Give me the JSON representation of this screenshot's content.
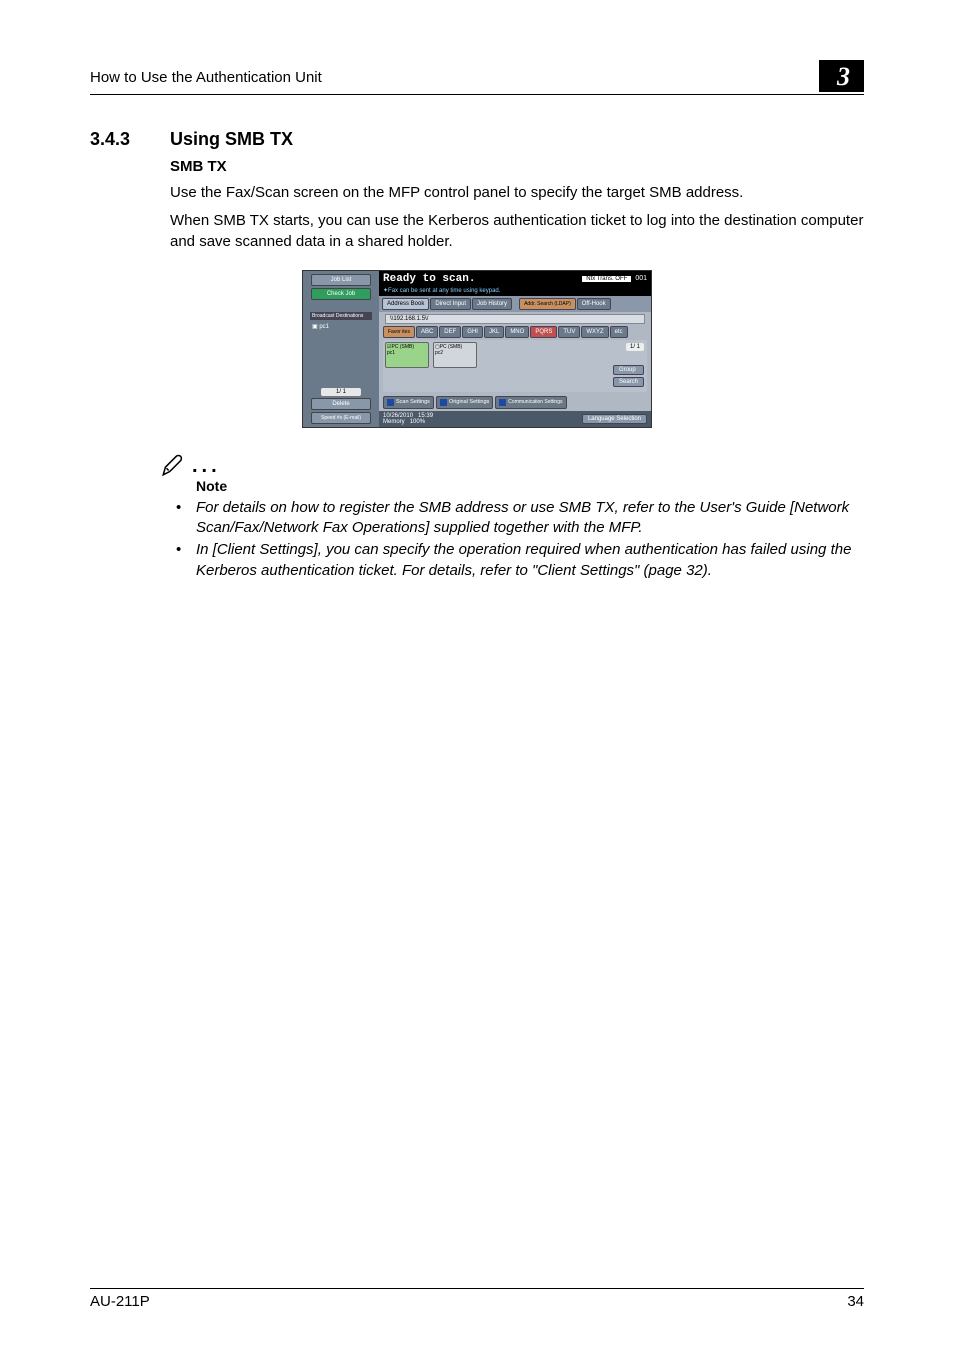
{
  "header": {
    "runningTitle": "How to Use the Authentication Unit",
    "chapterNumber": "3"
  },
  "section": {
    "number": "3.4.3",
    "title": "Using SMB TX",
    "subheading": "SMB TX",
    "paragraph1": "Use the Fax/Scan screen on the MFP control panel to specify the target SMB address.",
    "paragraph2": "When SMB TX starts, you can use the Kerberos authentication ticket to log into the destination computer and save scanned data in a shared holder."
  },
  "panel": {
    "left": {
      "jobList": "Job List",
      "checkJob": "Check Job",
      "destTitle": "Broadcast Destinations",
      "destItem": "▣ pc1",
      "pager": "1/  1",
      "delete": "Delete",
      "speed": "Speed #s (E-mail)"
    },
    "status": {
      "title": "Ready to scan.",
      "hint": "✦Fax can be sent at any time using keypad.",
      "memLabel": "Ntx Trans. OFF",
      "count": "001"
    },
    "tabs": {
      "addressBook": "Address Book",
      "directInput": "Direct Input",
      "jobHistory": "Job History",
      "addrSearch": "Addr. Search (LDAP)",
      "offHook": "Off-Hook"
    },
    "path": "\\\\192.168.1.5\\/",
    "alpha": [
      "Favor ites",
      "ABC",
      "DEF",
      "GHI",
      "JKL",
      "MNO",
      "PQRS",
      "TUV",
      "WXYZ",
      "etc"
    ],
    "smb": {
      "box1top": "☑PC (SMB)",
      "box1bot": "pc1",
      "box2top": "▢PC (SMB)",
      "box2bot": "pc2"
    },
    "contentPager": "1/  1",
    "side": {
      "group": "Group",
      "search": "Search"
    },
    "bottom": {
      "scan": "Scan Settings",
      "orig": "Original Settings",
      "comm": "Communication Settings"
    },
    "footer": {
      "date": "10/26/2010",
      "time": "15:39",
      "memLabel": "Memory",
      "memVal": "100%",
      "lang": "Language Selection"
    }
  },
  "note": {
    "label": "Note",
    "bullet1": "For details on how to register the SMB address or use SMB TX, refer to the User's Guide [Network Scan/Fax/Network Fax Operations] supplied together with the MFP.",
    "bullet2": "In [Client Settings], you can specify the operation required when authentication has failed using the Kerberos authentication ticket. For details, refer to \"Client Settings\" (page 32)."
  },
  "pageFooter": {
    "left": "AU-211P",
    "right": "34"
  }
}
